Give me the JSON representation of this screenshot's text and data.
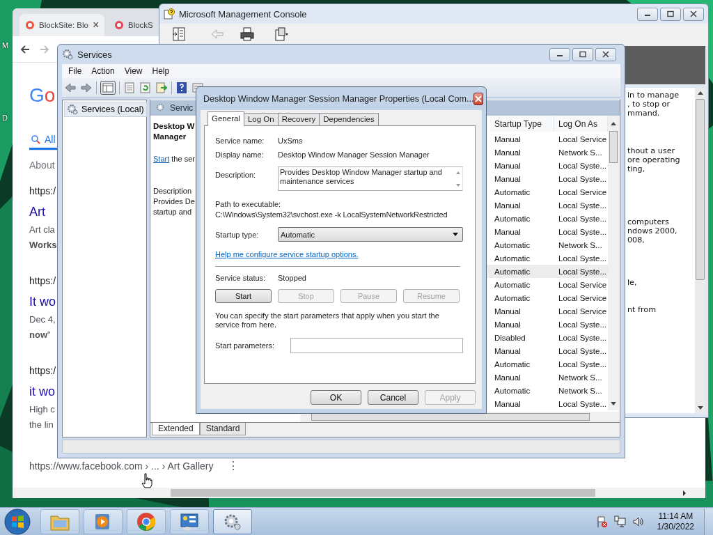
{
  "desktop": {
    "icon_labels": [
      "M",
      "D"
    ]
  },
  "browser": {
    "tabs": [
      {
        "label": "BlockSite: Blo",
        "selected": true,
        "close": "×"
      },
      {
        "label": "BlockS",
        "selected": false
      }
    ],
    "logo": "Go",
    "search_tabs": [
      {
        "label": "All",
        "selected": true
      }
    ],
    "about": "About",
    "results": [
      {
        "url": "https:/",
        "title": "Art",
        "lines": [
          {
            "text": "Art cla",
            "bold": false
          },
          {
            "text": "Works",
            "bold": true
          }
        ]
      },
      {
        "url": "https:/",
        "title": "It wo",
        "lines": [
          {
            "text": "Dec 4,",
            "bold": false
          },
          {
            "text": "**now**\"",
            "bold": false
          }
        ]
      },
      {
        "url": "https:/",
        "title": "it wo",
        "lines": [
          {
            "text": "High c",
            "bold": false
          },
          {
            "text": "the lin",
            "bold": false
          }
        ]
      }
    ],
    "footer_url": "https://www.facebook.com › ... › Art Gallery",
    "more": "⋮"
  },
  "mmc": {
    "title": "Microsoft Management Console",
    "paragraphs": [
      [
        "in to manage",
        ", to stop or",
        "mmand."
      ],
      [
        "thout a user",
        "ore operating",
        "ting,"
      ],
      [
        "computers",
        "ndows 2000,",
        "008,"
      ],
      [
        "le,"
      ],
      [
        "nt from"
      ]
    ]
  },
  "services": {
    "title": "Services",
    "menu": [
      "File",
      "Action",
      "View",
      "Help"
    ],
    "tree": [
      {
        "label": "Services (Local)",
        "selected": true
      }
    ],
    "header": "Servic",
    "detail": {
      "title_lines": [
        "Desktop W",
        "Manager"
      ],
      "action_link": "Start",
      "action_rest": " the ser",
      "description_lines": [
        "Description",
        "Provides De",
        "startup and"
      ]
    },
    "columns": [
      "Startup Type",
      "Log On As"
    ],
    "rows": [
      {
        "startup": "Manual",
        "logon": "Local Service",
        "selected": false
      },
      {
        "startup": "Manual",
        "logon": "Network S...",
        "selected": false
      },
      {
        "startup": "Manual",
        "logon": "Local Syste...",
        "selected": false
      },
      {
        "startup": "Manual",
        "logon": "Local Syste...",
        "selected": false
      },
      {
        "startup": "Automatic",
        "logon": "Local Service",
        "selected": false
      },
      {
        "startup": "Manual",
        "logon": "Local Syste...",
        "selected": false
      },
      {
        "startup": "Automatic",
        "logon": "Local Syste...",
        "selected": false
      },
      {
        "startup": "Manual",
        "logon": "Local Syste...",
        "selected": false
      },
      {
        "startup": "Automatic",
        "logon": "Network S...",
        "selected": false
      },
      {
        "startup": "Automatic",
        "logon": "Local Syste...",
        "selected": false
      },
      {
        "startup": "Automatic",
        "logon": "Local Syste...",
        "selected": true
      },
      {
        "startup": "Automatic",
        "logon": "Local Service",
        "selected": false
      },
      {
        "startup": "Automatic",
        "logon": "Local Service",
        "selected": false
      },
      {
        "startup": "Manual",
        "logon": "Local Service",
        "selected": false
      },
      {
        "startup": "Manual",
        "logon": "Local Syste...",
        "selected": false
      },
      {
        "startup": "Disabled",
        "logon": "Local Syste...",
        "selected": false
      },
      {
        "startup": "Manual",
        "logon": "Local Syste...",
        "selected": false
      },
      {
        "startup": "Automatic",
        "logon": "Local Syste...",
        "selected": false
      },
      {
        "startup": "Manual",
        "logon": "Network S...",
        "selected": false
      },
      {
        "startup": "Automatic",
        "logon": "Network S...",
        "selected": false
      },
      {
        "startup": "Manual",
        "logon": "Local Syste...",
        "selected": false
      }
    ],
    "view_tabs": [
      {
        "label": "Extended",
        "selected": true
      },
      {
        "label": "Standard",
        "selected": false
      }
    ]
  },
  "dialog": {
    "title": "Desktop Window Manager Session Manager Properties (Local Com...",
    "tabs": [
      {
        "label": "General",
        "selected": true
      },
      {
        "label": "Log On",
        "selected": false
      },
      {
        "label": "Recovery",
        "selected": false
      },
      {
        "label": "Dependencies",
        "selected": false
      }
    ],
    "service_name": {
      "label": "Service name:",
      "value": "UxSms"
    },
    "display_name": {
      "label": "Display name:",
      "value": "Desktop Window Manager Session Manager"
    },
    "description": {
      "label": "Description:",
      "value": "Provides Desktop Window Manager startup and maintenance services"
    },
    "path": {
      "label": "Path to executable:",
      "value": "C:\\Windows\\System32\\svchost.exe -k LocalSystemNetworkRestricted"
    },
    "startup_type": {
      "label": "Startup type:",
      "value": "Automatic"
    },
    "help_link": "Help me configure service startup options.",
    "service_status": {
      "label": "Service status:",
      "value": "Stopped"
    },
    "control_buttons": [
      {
        "label": "Start",
        "disabled": false
      },
      {
        "label": "Stop",
        "disabled": true
      },
      {
        "label": "Pause",
        "disabled": true
      },
      {
        "label": "Resume",
        "disabled": true
      }
    ],
    "note": "You can specify the start parameters that apply when you start the service from here.",
    "start_parameters": {
      "label": "Start parameters:"
    },
    "buttons": [
      {
        "label": "OK",
        "disabled": false
      },
      {
        "label": "Cancel",
        "disabled": false
      },
      {
        "label": "Apply",
        "disabled": true
      }
    ]
  },
  "taskbar": {
    "apps": [
      {
        "kind": "explorer",
        "active": false
      },
      {
        "kind": "media",
        "active": false
      },
      {
        "kind": "chrome",
        "active": false
      },
      {
        "kind": "control-panel",
        "active": false
      },
      {
        "kind": "services",
        "active": true
      }
    ],
    "clock": {
      "time": "11:14 AM",
      "date": "1/30/2022"
    }
  }
}
